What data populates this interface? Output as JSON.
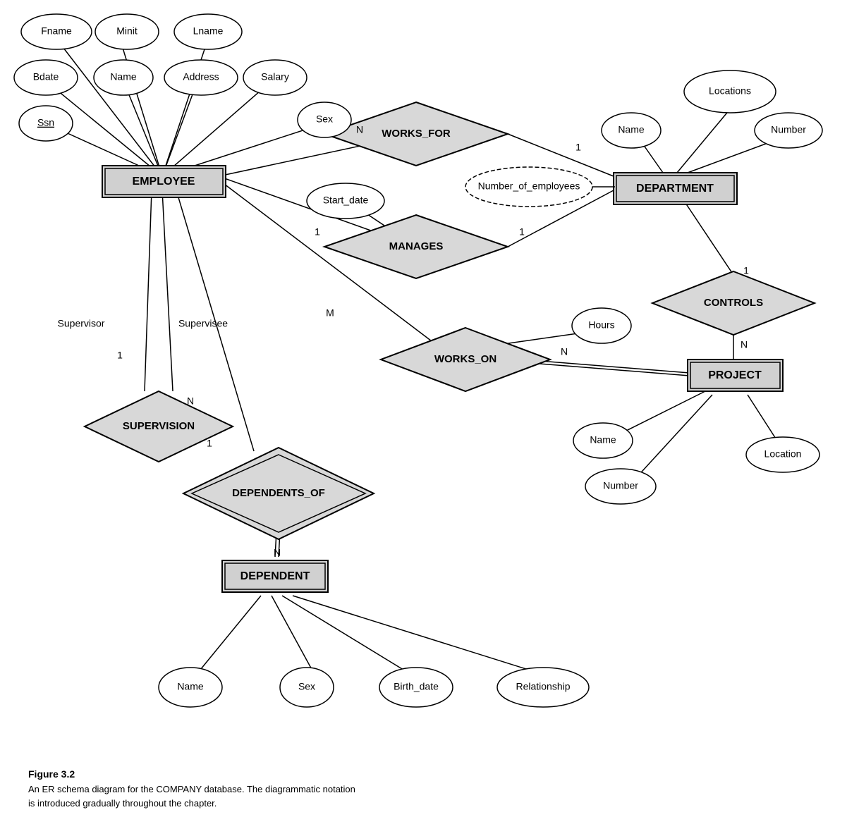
{
  "caption": {
    "title": "Figure 3.2",
    "line1": "An ER schema diagram for the COMPANY database. The diagrammatic notation",
    "line2": "is introduced gradually throughout the chapter."
  },
  "entities": {
    "employee": "EMPLOYEE",
    "department": "DEPARTMENT",
    "project": "PROJECT",
    "dependent": "DEPENDENT"
  },
  "relationships": {
    "works_for": "WORKS_FOR",
    "manages": "MANAGES",
    "works_on": "WORKS_ON",
    "supervision": "SUPERVISION",
    "dependents_of": "DEPENDENTS_OF",
    "controls": "CONTROLS"
  },
  "attributes": {
    "fname": "Fname",
    "minit": "Minit",
    "lname": "Lname",
    "bdate": "Bdate",
    "name_emp": "Name",
    "address": "Address",
    "salary": "Salary",
    "ssn": "Ssn",
    "sex_emp": "Sex",
    "start_date": "Start_date",
    "number_of_employees": "Number_of_employees",
    "locations": "Locations",
    "name_dept": "Name",
    "number_dept": "Number",
    "hours": "Hours",
    "name_proj": "Name",
    "number_proj": "Number",
    "location_proj": "Location",
    "name_dep": "Name",
    "sex_dep": "Sex",
    "birth_date": "Birth_date",
    "relationship": "Relationship"
  },
  "cardinalities": {
    "n1": "N",
    "one1": "1",
    "one2": "1",
    "one3": "1",
    "n2": "N",
    "n3": "N",
    "m1": "M",
    "one4": "1",
    "n4": "N",
    "supervisor": "Supervisor",
    "supervisee": "Supervisee"
  }
}
